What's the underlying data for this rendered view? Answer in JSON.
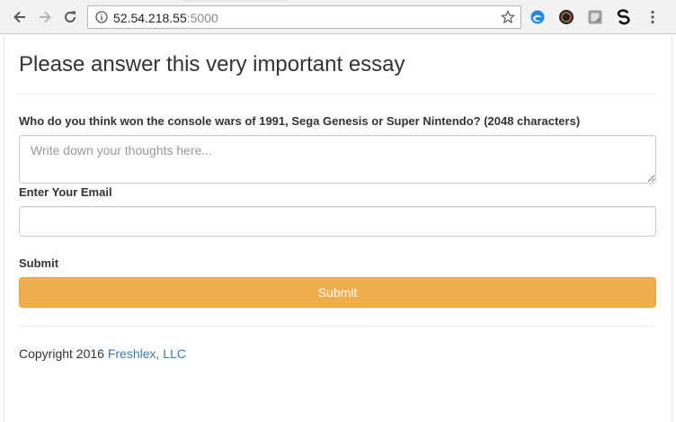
{
  "browser": {
    "url_host": "52.54.218.55",
    "url_port": ":5000",
    "extensions": [
      "edge-extension-icon",
      "color-picker-extension-icon",
      "note-extension-icon",
      "s-extension-icon"
    ]
  },
  "page": {
    "title": "Please answer this very important essay",
    "question_label": "Who do you think won the console wars of 1991, Sega Genesis or Super Nintendo? (2048 characters)",
    "essay_placeholder": "Write down your thoughts here...",
    "essay_value": "",
    "email_label": "Enter Your Email",
    "email_value": "",
    "submit_label": "Submit",
    "submit_button": "Submit",
    "submit_color": "#f0ad4e"
  },
  "footer": {
    "text": "Copyright 2016 ",
    "link": "Freshlex, LLC",
    "link_color": "#337ab7"
  }
}
